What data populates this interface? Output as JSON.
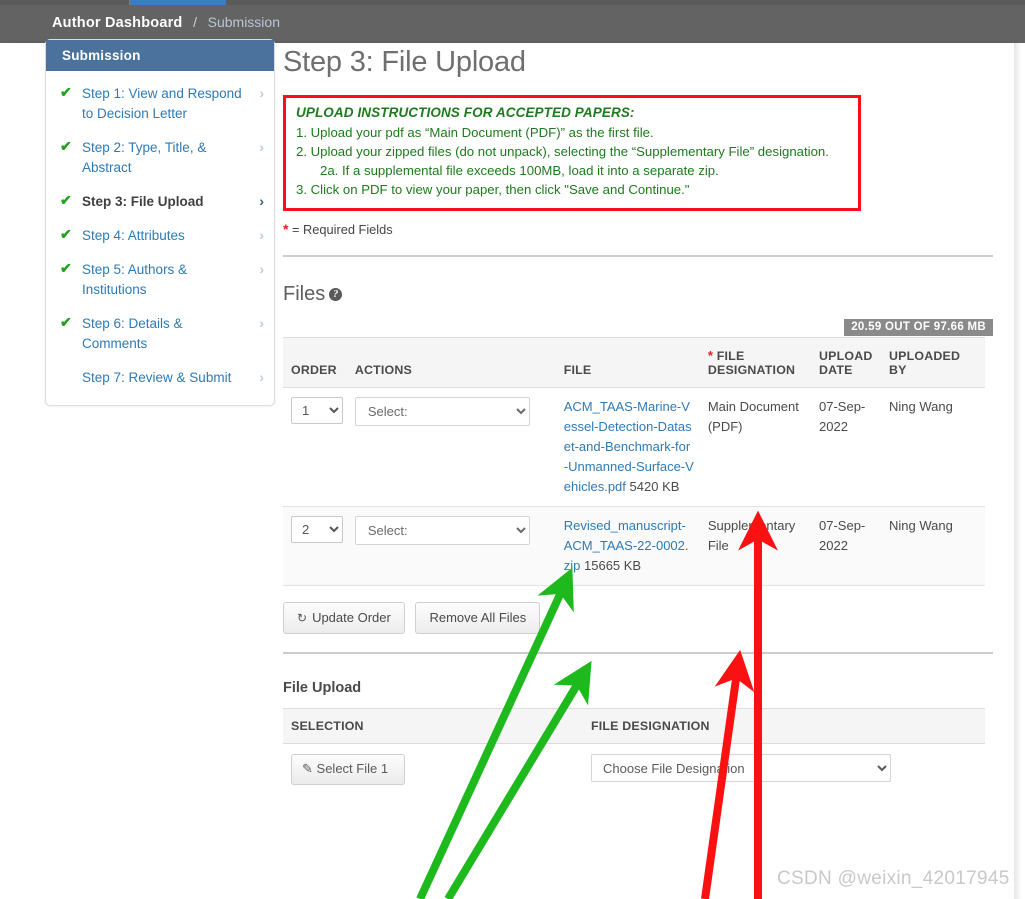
{
  "topnav": {
    "breadcrumb_root": "Author Dashboard",
    "breadcrumb_sep": "/",
    "breadcrumb_current": "Submission",
    "active_tab_color": "#3e7cc0",
    "bar_color": "#636363"
  },
  "sidebar": {
    "header": "Submission",
    "header_color": "#4a729c",
    "check_color": "#21a321",
    "items": [
      {
        "label": "Step 1: View and Respond to Decision Letter",
        "checked": true,
        "current": false
      },
      {
        "label": "Step 2: Type, Title, & Abstract",
        "checked": true,
        "current": false
      },
      {
        "label": "Step 3: File Upload",
        "checked": true,
        "current": true
      },
      {
        "label": "Step 4: Attributes",
        "checked": true,
        "current": false
      },
      {
        "label": "Step 5: Authors & Institutions",
        "checked": true,
        "current": false
      },
      {
        "label": "Step 6: Details & Comments",
        "checked": true,
        "current": false
      },
      {
        "label": "Step 7: Review & Submit",
        "checked": false,
        "current": false
      }
    ]
  },
  "main": {
    "page_title": "Step 3: File Upload",
    "instructions": {
      "border_color": "#fc0d1b",
      "text_color": "#1f7a1f",
      "title": "UPLOAD INSTRUCTIONS FOR ACCEPTED PAPERS:",
      "lines": [
        {
          "text": "1. Upload your pdf as “Main Document (PDF)” as the first file.",
          "indent": false
        },
        {
          "text": "2. Upload your zipped files (do not unpack), selecting the “Supplementary File” designation.",
          "indent": false
        },
        {
          "text": "2a. If a supplemental file exceeds 100MB, load it into a separate zip.",
          "indent": true
        },
        {
          "text": "3. Click on PDF to view your paper, then click \"Save and Continue.\"",
          "indent": false
        }
      ]
    },
    "required_star": "*",
    "required_note": " = Required Fields",
    "files_section": {
      "heading": "Files",
      "help_icon": "help-icon",
      "quota_badge": "20.59 OUT OF 97.66 MB",
      "quota_badge_color": "#8a8a8a",
      "columns": [
        "ORDER",
        "ACTIONS",
        "FILE",
        "FILE DESIGNATION",
        "UPLOAD DATE",
        "UPLOADED BY"
      ],
      "designation_required": true,
      "rows": [
        {
          "order": "1",
          "order_options": [
            "1",
            "2"
          ],
          "action_placeholder": "Select:",
          "file_name": "ACM_TAAS-Marine-Vessel-Detection-Dataset-and-Benchmark-for-Unmanned-Surface-Vehicles.pdf",
          "file_size": "5420 KB",
          "designation": "Main Document (PDF)",
          "upload_date": "07-Sep-2022",
          "uploaded_by": "Ning Wang"
        },
        {
          "order": "2",
          "order_options": [
            "1",
            "2"
          ],
          "action_placeholder": "Select:",
          "file_name": "Revised_manuscript-ACM_TAAS-22-0002.zip",
          "file_size": "15665 KB",
          "designation": "Supplementary File",
          "upload_date": "07-Sep-2022",
          "uploaded_by": "Ning Wang"
        }
      ],
      "buttons": [
        {
          "label": "Update Order",
          "icon": "refresh-icon"
        },
        {
          "label": "Remove All Files",
          "icon": null
        }
      ]
    },
    "upload_section": {
      "heading": "File Upload",
      "columns": [
        "SELECTION",
        "FILE DESIGNATION"
      ],
      "select_file_label": "Select File 1",
      "select_file_icon": "paperclip-icon",
      "designation_placeholder": "Choose File Designation"
    }
  },
  "annotations": {
    "green_color": "#1db91d",
    "red_color": "#fb1111",
    "arrows": [
      {
        "name": "green-arrow-main-document-file",
        "color": "#1db91d"
      },
      {
        "name": "green-arrow-supplementary-file",
        "color": "#1db91d"
      },
      {
        "name": "red-arrow-main-document-designation",
        "color": "#fb1111"
      },
      {
        "name": "red-arrow-supplementary-designation",
        "color": "#fb1111"
      }
    ]
  },
  "watermark": "CSDN @weixin_42017945"
}
